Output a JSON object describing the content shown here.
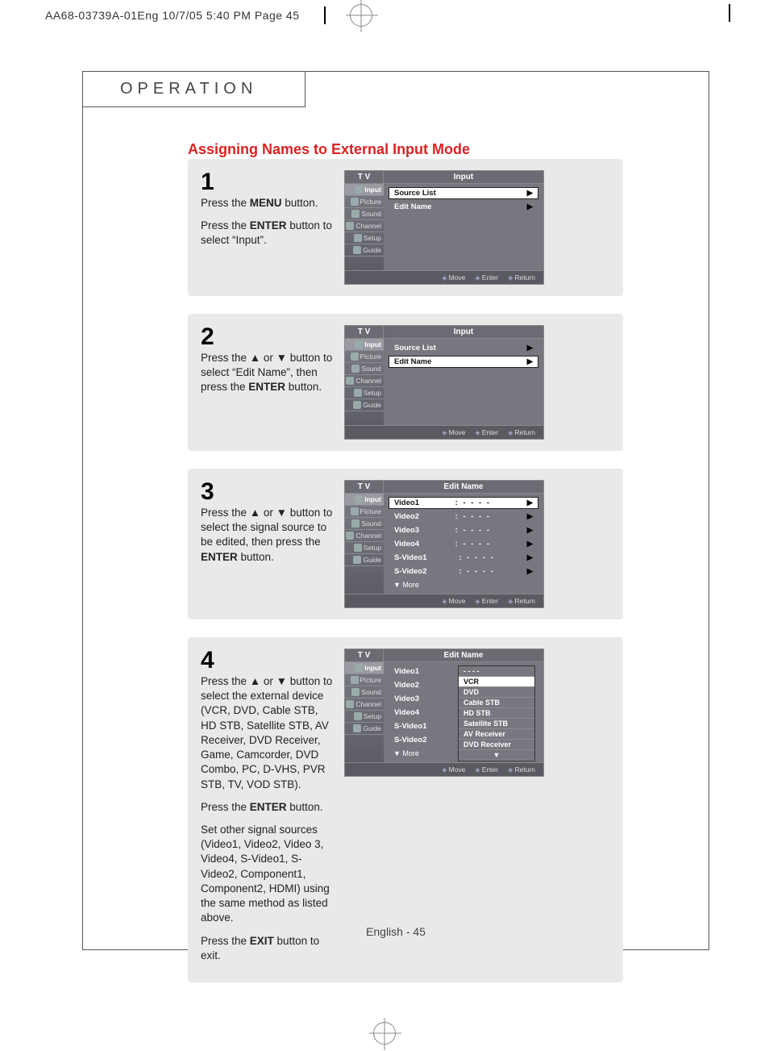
{
  "print_header": "AA68-03739A-01Eng  10/7/05  5:40 PM  Page 45",
  "chapter": "OPERATION",
  "section_title": "Assigning Names to External Input Mode",
  "osd_common": {
    "tv": "T V",
    "side_tabs": [
      "Input",
      "Picture",
      "Sound",
      "Channel",
      "Setup",
      "Guide"
    ],
    "foot_move": "Move",
    "foot_enter": "Enter",
    "foot_return": "Return"
  },
  "steps": [
    {
      "num": "1",
      "paras": [
        "Press the <b>MENU</b> button.",
        "Press the <b>ENTER</b> button to select “Input”."
      ],
      "osd": {
        "title": "Input",
        "rows": [
          {
            "label": "Source List",
            "sel": true,
            "caret": true
          },
          {
            "label": "Edit Name",
            "plain": true,
            "caret": true
          }
        ]
      }
    },
    {
      "num": "2",
      "paras": [
        "Press the ▲ or ▼ button to select “Edit Name”, then press the <b>ENTER</b> button."
      ],
      "osd": {
        "title": "Input",
        "rows": [
          {
            "label": "Source List",
            "plain_top": true,
            "caret": true
          },
          {
            "label": "Edit Name",
            "sel": true,
            "caret": true
          }
        ]
      }
    },
    {
      "num": "3",
      "paras": [
        "Press the ▲ or ▼ button to select the signal source to be edited, then press the <b>ENTER</b> button."
      ],
      "osd": {
        "title": "Edit Name",
        "rows": [
          {
            "label": "Video1",
            "mid": ": - - - -",
            "sel": true,
            "caret": true
          },
          {
            "label": "Video2",
            "mid": ": - - - -",
            "plain": true,
            "caret": true
          },
          {
            "label": "Video3",
            "mid": ": - - - -",
            "plain": true,
            "caret": true
          },
          {
            "label": "Video4",
            "mid": ": - - - -",
            "plain": true,
            "caret": true
          },
          {
            "label": "S-Video1",
            "mid": ": - - - -",
            "plain": true,
            "caret": true
          },
          {
            "label": "S-Video2",
            "mid": ": - - - -",
            "plain": true,
            "caret": true
          }
        ],
        "more": "▼ More"
      }
    },
    {
      "num": "4",
      "paras": [
        "Press the ▲ or ▼ button to select the external device (VCR, DVD, Cable STB, HD STB, Satellite STB, AV Receiver, DVD Receiver, Game, Camcorder, DVD Combo, PC, D-VHS, PVR STB, TV, VOD STB).",
        "Press the <b>ENTER</b> button.",
        "Set other signal sources (Video1,  Video2,  Video 3, Video4, S-Video1,  S-Video2, Component1, Component2, HDMI) using the same method as listed above.",
        "Press the <b>EXIT</b> button to exit."
      ],
      "osd": {
        "title": "Edit Name",
        "rows": [
          {
            "label": "Video1",
            "mid": ":",
            "plain": true
          },
          {
            "label": "Video2",
            "mid": ":",
            "plain": true
          },
          {
            "label": "Video3",
            "mid": ":",
            "plain": true
          },
          {
            "label": "Video4",
            "mid": ":",
            "plain": true
          },
          {
            "label": "S-Video1",
            "mid": ":",
            "plain": true
          },
          {
            "label": "S-Video2",
            "mid": ":",
            "plain": true
          }
        ],
        "more": "▼ More",
        "popup": [
          "- - - -",
          "VCR",
          "DVD",
          "Cable STB",
          "HD STB",
          "Satellite STB",
          "AV Receiver",
          "DVD Receiver"
        ],
        "popup_sel": 1
      }
    }
  ],
  "page_foot": "English - 45"
}
